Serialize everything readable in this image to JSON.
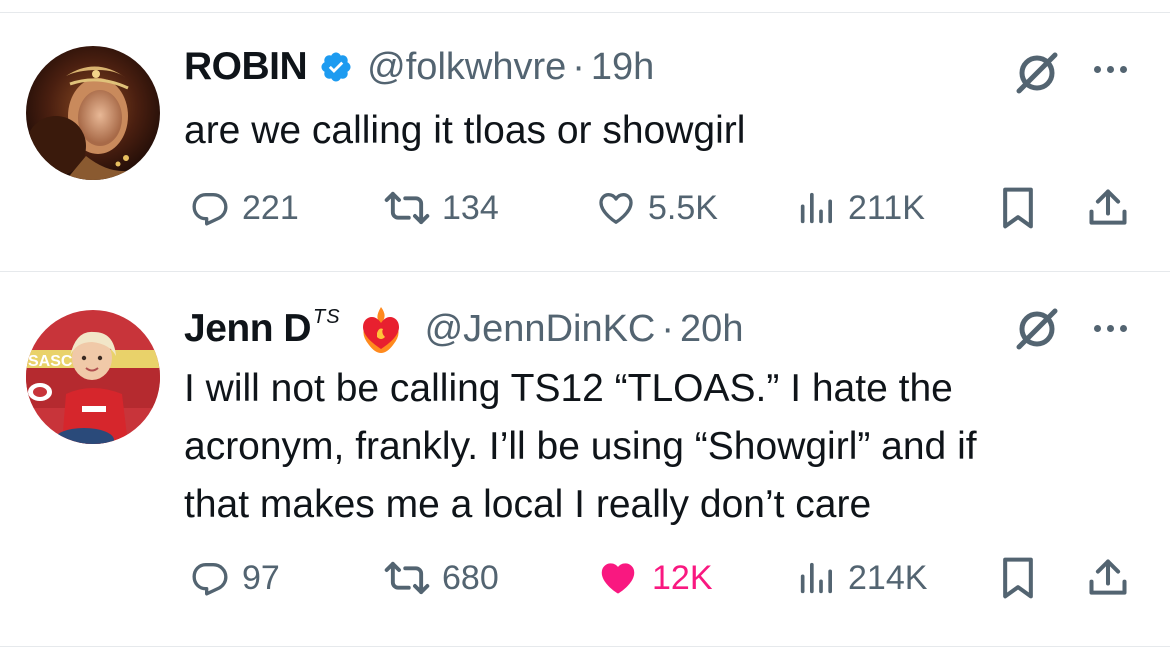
{
  "tweets": [
    {
      "name": "ROBIN",
      "handle": "@folkwhvre",
      "separator": "·",
      "time": "19h",
      "text": "are we calling it tloas or showgirl",
      "replies": "221",
      "reposts": "134",
      "likes": "5.5K",
      "views": "211K",
      "liked": false,
      "verified": true
    },
    {
      "name": "Jenn D",
      "name_suffix": "TS",
      "handle": "@JennDinKC",
      "separator": "·",
      "time": "20h",
      "text_lines": [
        "I will not be calling TS12 “TLOAS.” I hate the",
        "acronym, frankly. I’ll be using “Showgirl” and if",
        "that makes me a local I really don’t care"
      ],
      "replies": "97",
      "reposts": "680",
      "likes": "12K",
      "views": "214K",
      "liked": true
    }
  ],
  "colors": {
    "text": "#0f1419",
    "secondary": "#536471",
    "verified": "#1d9bf0",
    "like": "#f91880",
    "divider": "#e6e9ec"
  },
  "icons": [
    "verified-badge-icon",
    "grok-icon",
    "more-icon",
    "reply-icon",
    "repost-icon",
    "like-icon",
    "views-icon",
    "bookmark-icon",
    "share-icon",
    "heart-on-fire-emoji"
  ]
}
